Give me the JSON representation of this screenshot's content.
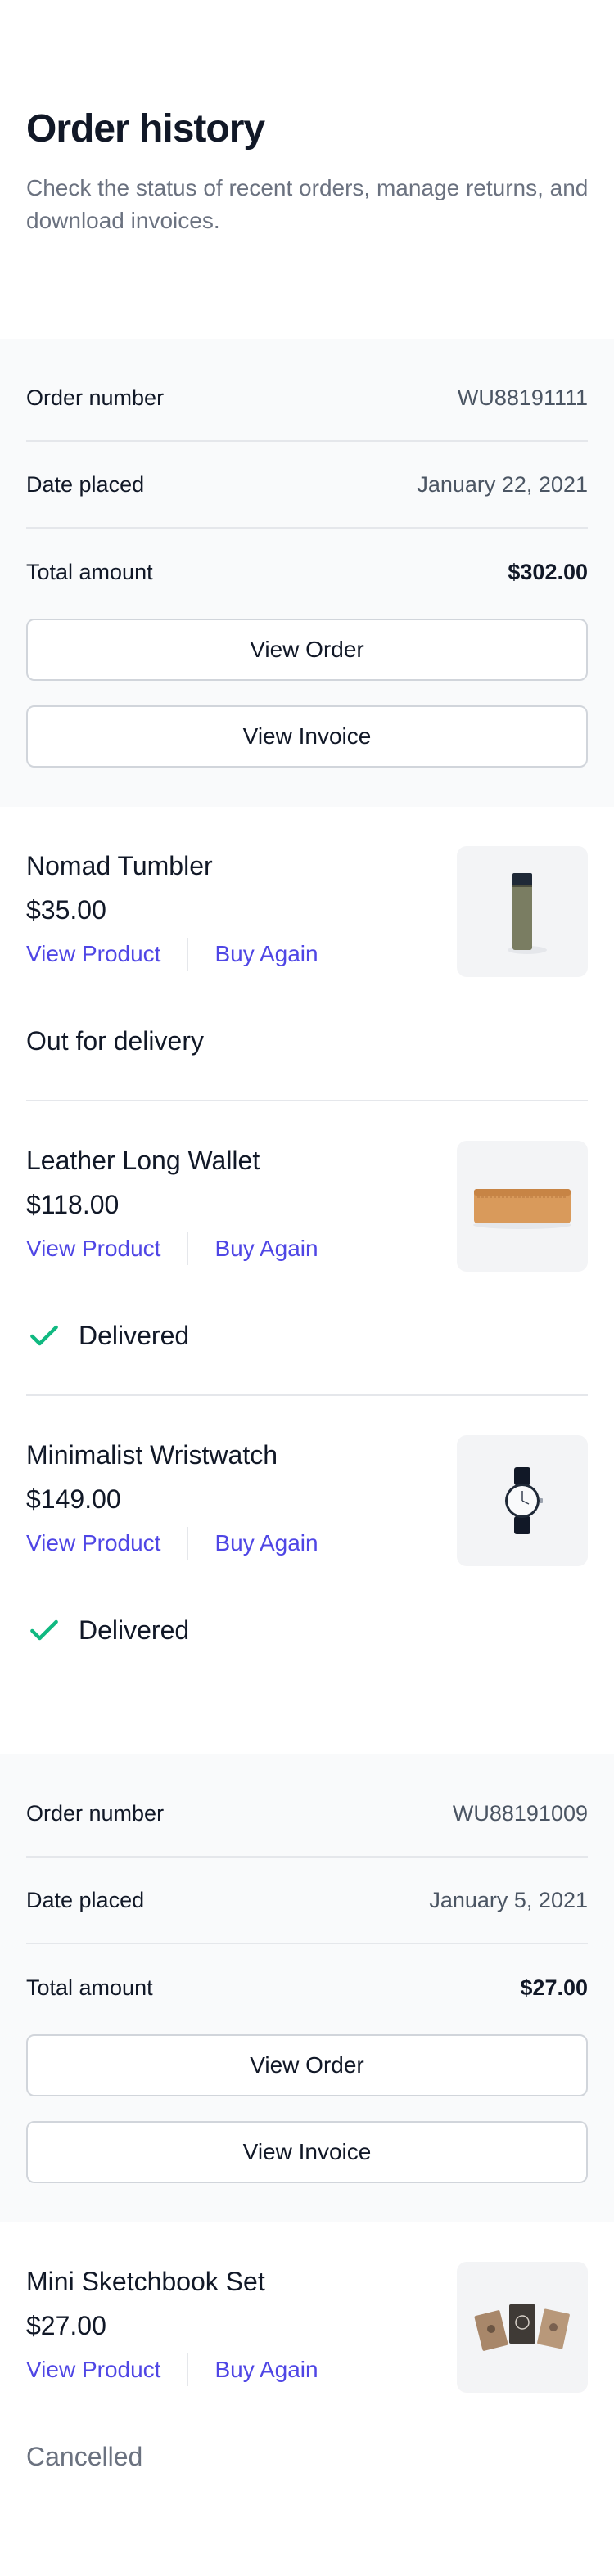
{
  "header": {
    "title": "Order history",
    "subtitle": "Check the status of recent orders, manage returns, and download invoices."
  },
  "orders": [
    {
      "summary": {
        "order_number_label": "Order number",
        "order_number": "WU88191111",
        "date_label": "Date placed",
        "date": "January 22, 2021",
        "total_label": "Total amount",
        "total": "$302.00",
        "view_order": "View Order",
        "view_invoice": "View Invoice"
      },
      "items": [
        {
          "name": "Nomad Tumbler",
          "price": "$35.00",
          "view_product": "View Product",
          "buy_again": "Buy Again",
          "status": "Out for delivery",
          "icon": "tumbler-icon"
        },
        {
          "name": "Leather Long Wallet",
          "price": "$118.00",
          "view_product": "View Product",
          "buy_again": "Buy Again",
          "status": "Delivered",
          "icon": "wallet-icon"
        },
        {
          "name": "Minimalist Wristwatch",
          "price": "$149.00",
          "view_product": "View Product",
          "buy_again": "Buy Again",
          "status": "Delivered",
          "icon": "watch-icon"
        }
      ]
    },
    {
      "summary": {
        "order_number_label": "Order number",
        "order_number": "WU88191009",
        "date_label": "Date placed",
        "date": "January 5, 2021",
        "total_label": "Total amount",
        "total": "$27.00",
        "view_order": "View Order",
        "view_invoice": "View Invoice"
      },
      "items": [
        {
          "name": "Mini Sketchbook Set",
          "price": "$27.00",
          "view_product": "View Product",
          "buy_again": "Buy Again",
          "status": "Cancelled",
          "icon": "sketchbook-icon"
        }
      ]
    }
  ],
  "colors": {
    "accent": "#4f46e5",
    "delivered_check": "#10b981",
    "muted": "#6b7280"
  }
}
